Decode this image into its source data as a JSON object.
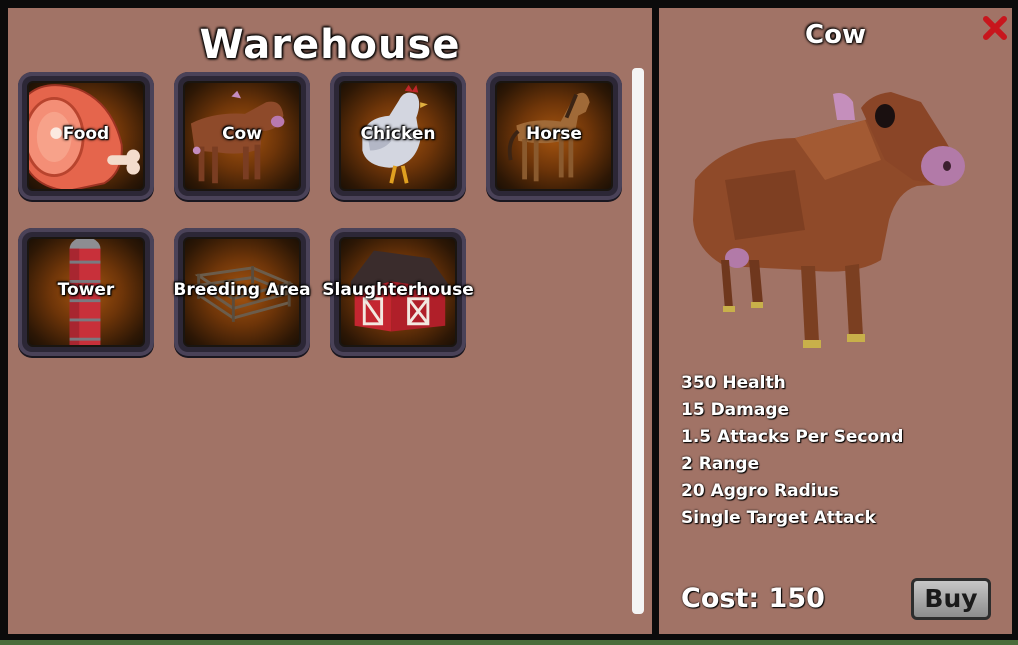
{
  "warehouse": {
    "title": "Warehouse",
    "items": [
      {
        "label": "Food",
        "icon": "meat-icon"
      },
      {
        "label": "Cow",
        "icon": "cow-icon"
      },
      {
        "label": "Chicken",
        "icon": "chicken-icon"
      },
      {
        "label": "Horse",
        "icon": "horse-icon"
      },
      {
        "label": "Tower",
        "icon": "silo-tower-icon"
      },
      {
        "label": "Breeding Area",
        "icon": "fence-pen-icon"
      },
      {
        "label": "Slaughterhouse",
        "icon": "red-barn-icon"
      }
    ]
  },
  "detail": {
    "name": "Cow",
    "stats": [
      "350 Health",
      "15 Damage",
      "1.5 Attacks Per Second",
      "2 Range",
      "20 Aggro Radius",
      "Single Target Attack"
    ],
    "cost": "Cost: 150",
    "buy_label": "Buy",
    "close_icon": "close-x-icon"
  },
  "colors": {
    "panel": "#a17366",
    "frame": "#0b0b0b",
    "slot_border": "#4a4258",
    "close": "#c8161d"
  }
}
